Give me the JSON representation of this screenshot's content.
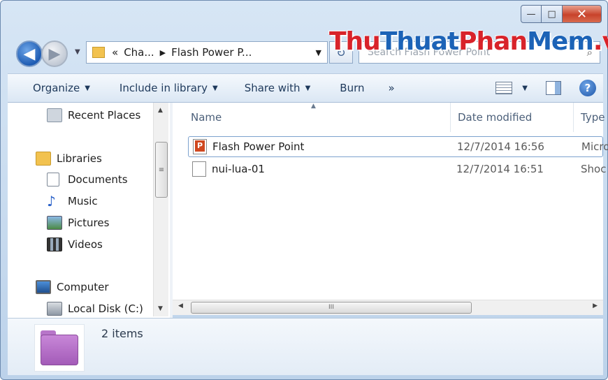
{
  "window": {
    "minimize_glyph": "—",
    "maximize_glyph": "□",
    "close_glyph": "✕"
  },
  "watermark": {
    "part_red_1": "Thu",
    "part_blue_1": "Thuat",
    "part_red_2": "Phan",
    "part_blue_2": "Mem",
    "part_red_3": ".vn"
  },
  "address_bar": {
    "overflow": "«",
    "crumbs": [
      "Cha...",
      "Flash Power P..."
    ],
    "separator": "▶",
    "dropdown": "▼"
  },
  "search": {
    "placeholder": "Search Flash Power Point",
    "icon": "magnifier-icon"
  },
  "toolbar": {
    "organize": "Organize",
    "include_in_library": "Include in library",
    "share_with": "Share with",
    "burn": "Burn",
    "more": "»",
    "help": "?"
  },
  "nav_pane": {
    "items": [
      {
        "label": "Recent Places",
        "icon": "recent-places-icon"
      },
      {
        "label": "Libraries",
        "icon": "libraries-icon"
      },
      {
        "label": "Documents",
        "icon": "documents-icon"
      },
      {
        "label": "Music",
        "icon": "music-icon"
      },
      {
        "label": "Pictures",
        "icon": "pictures-icon"
      },
      {
        "label": "Videos",
        "icon": "videos-icon"
      },
      {
        "label": "Computer",
        "icon": "computer-icon"
      },
      {
        "label": "Local Disk (C:)",
        "icon": "local-disk-icon"
      }
    ]
  },
  "file_list": {
    "columns": [
      "Name",
      "Date modified",
      "Type"
    ],
    "rows": [
      {
        "name": "Flash Power Point",
        "date": "12/7/2014 16:56",
        "type": "Micro",
        "icon": "powerpoint-file-icon",
        "selected": true
      },
      {
        "name": "nui-lua-01",
        "date": "12/7/2014 16:51",
        "type": "Shoc",
        "icon": "generic-file-icon",
        "selected": false
      }
    ]
  },
  "scrollbar_grip": "III",
  "details_pane": {
    "item_count": "2 items",
    "icon": "folder-icon"
  }
}
